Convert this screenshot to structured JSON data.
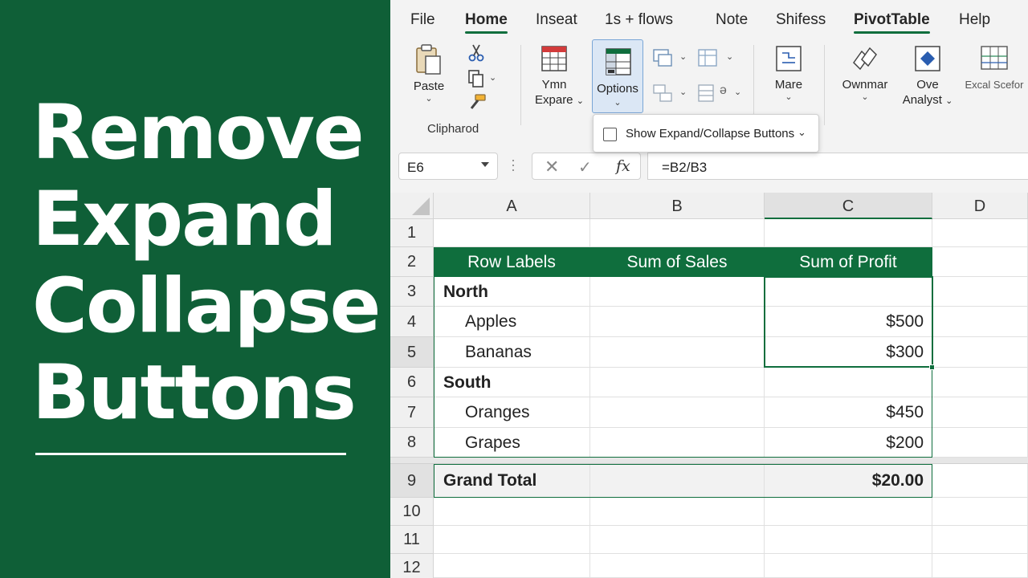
{
  "banner": {
    "title_lines": [
      "Remove",
      "Expand",
      "Collapse",
      "Buttons"
    ]
  },
  "tabs": [
    "File",
    "Home",
    "Inseat",
    "1s + flows",
    "Note",
    "Shifess",
    "PivotTable",
    "Help"
  ],
  "ribbon": {
    "paste_label": "Paste",
    "clipboard_group": "Clipharod",
    "expand_label_1": "Ymn",
    "expand_label_2": "Expare",
    "options_label": "Options",
    "more_label": "Mare",
    "ownmar_label": "Ownmar",
    "analyst_label_1": "Ove",
    "analyst_label_2": "Analyst",
    "excel_label": "Excal Scefor",
    "small_icon_text": "ə"
  },
  "dropdown": {
    "option_label": "Show  Expand/Collapse Buttons"
  },
  "formula_bar": {
    "name_box": "E6",
    "formula": "=B2/B3",
    "cancel_glyph": "✕",
    "confirm_glyph": "✓",
    "fx_glyph": "fx"
  },
  "grid": {
    "columns": [
      "A",
      "B",
      "C",
      "D"
    ],
    "rows": [
      "1",
      "2",
      "3",
      "4",
      "5",
      "6",
      "7",
      "8",
      "9",
      "10",
      "11",
      "12"
    ],
    "pivot": {
      "headers": [
        "Row Labels",
        "Sum of Sales",
        "Sum of Profit"
      ],
      "groups": [
        {
          "label": "North",
          "items": [
            {
              "label": "Apples",
              "profit": "$500"
            },
            {
              "label": "Bananas",
              "profit": "$300"
            }
          ]
        },
        {
          "label": "South",
          "items": [
            {
              "label": "Oranges",
              "profit": "$450"
            },
            {
              "label": "Grapes",
              "profit": "$200"
            }
          ]
        }
      ],
      "grand_total_label": "Grand Total",
      "grand_total_profit": "$20.00"
    }
  },
  "colors": {
    "brand_green": "#0f6e3d",
    "banner_green": "#0f5f37"
  }
}
